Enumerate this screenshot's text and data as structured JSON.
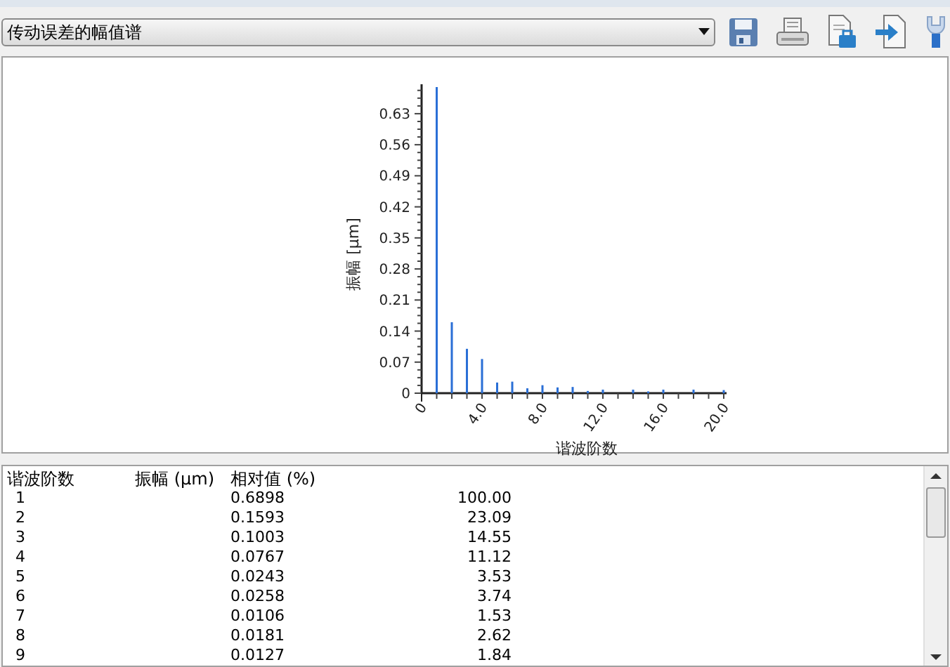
{
  "toolbar": {
    "dropdown": {
      "value": "传动误差的幅值谱"
    }
  },
  "chart": {
    "chart_data": {
      "type": "bar",
      "xlabel": "谐波阶数",
      "ylabel": "振幅 [μm]",
      "x": [
        1,
        2,
        3,
        4,
        5,
        6,
        7,
        8,
        9,
        10,
        11,
        12,
        13,
        14,
        15,
        16,
        17,
        18,
        19,
        20
      ],
      "series": [
        {
          "color": "#2a6fd6",
          "values": [
            0.69,
            0.16,
            0.1,
            0.077,
            0.024,
            0.026,
            0.011,
            0.018,
            0.013,
            0.014,
            0.005,
            0.008,
            null,
            0.008,
            0.004,
            0.008,
            null,
            0.008,
            null,
            0.007
          ]
        }
      ],
      "xlim": [
        0,
        20
      ],
      "ylim": [
        0,
        0.69
      ],
      "xticks": [
        {
          "value": 0,
          "label": "0"
        },
        {
          "value": 4,
          "label": "4.0"
        },
        {
          "value": 8,
          "label": "8.0"
        },
        {
          "value": 12,
          "label": "12.0"
        },
        {
          "value": 16,
          "label": "16.0"
        },
        {
          "value": 20,
          "label": "20.0"
        }
      ],
      "yticks": [
        {
          "value": 0,
          "label": "0"
        },
        {
          "value": 0.07,
          "label": "0.07"
        },
        {
          "value": 0.14,
          "label": "0.14"
        },
        {
          "value": 0.21,
          "label": "0.21"
        },
        {
          "value": 0.28,
          "label": "0.28"
        },
        {
          "value": 0.35,
          "label": "0.35"
        },
        {
          "value": 0.42,
          "label": "0.42"
        },
        {
          "value": 0.49,
          "label": "0.49"
        },
        {
          "value": 0.56,
          "label": "0.56"
        },
        {
          "value": 0.63,
          "label": "0.63"
        }
      ]
    }
  },
  "table": {
    "columns": [
      "谐波阶数",
      "振幅 (μm)",
      "相对值 (%)"
    ],
    "rows": [
      [
        "1",
        "",
        "0.6898",
        "100.00"
      ],
      [
        "2",
        "",
        "0.1593",
        "23.09"
      ],
      [
        "3",
        "",
        "0.1003",
        "14.55"
      ],
      [
        "4",
        "",
        "0.0767",
        "11.12"
      ],
      [
        "5",
        "",
        "0.0243",
        "3.53"
      ],
      [
        "6",
        "",
        "0.0258",
        "3.74"
      ],
      [
        "7",
        "",
        "0.0106",
        "1.53"
      ],
      [
        "8",
        "",
        "0.0181",
        "2.62"
      ],
      [
        "9",
        "",
        "0.0127",
        "1.84"
      ]
    ]
  }
}
